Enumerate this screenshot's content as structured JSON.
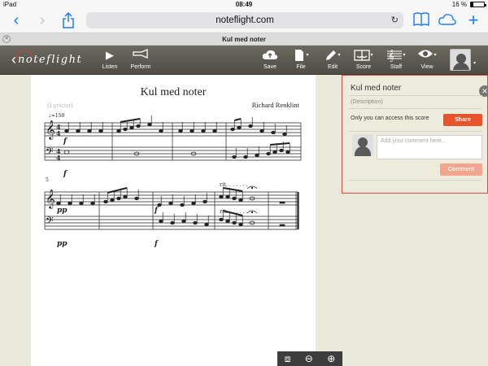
{
  "status": {
    "carrier": "iPad",
    "time": "08:49",
    "battery_text": "16 %",
    "battery_level": 0.16
  },
  "safari": {
    "back_icon": "chevron-left-icon",
    "forward_icon": "chevron-right-icon",
    "url": "noteflight.com",
    "tab_title": "Kul med noter"
  },
  "appbar": {
    "logo_text": "noteflight",
    "tools": [
      {
        "name": "listen",
        "label": "Listen",
        "icon": "play-icon",
        "has_menu": false
      },
      {
        "name": "perform",
        "label": "Perform",
        "icon": "horn-icon",
        "has_menu": false
      },
      {
        "name": "save",
        "label": "Save",
        "icon": "cloud-upload-icon",
        "has_menu": false
      },
      {
        "name": "file",
        "label": "File",
        "icon": "file-icon",
        "has_menu": true
      },
      {
        "name": "edit",
        "label": "Edit",
        "icon": "pencil-icon",
        "has_menu": true
      },
      {
        "name": "score",
        "label": "Score",
        "icon": "score-icon",
        "has_menu": true
      },
      {
        "name": "staff",
        "label": "Staff",
        "icon": "staff-icon",
        "has_menu": true
      },
      {
        "name": "view",
        "label": "View",
        "icon": "eye-icon",
        "has_menu": true
      }
    ]
  },
  "score": {
    "title": "Kul med noter",
    "composer": "Richard Renklint",
    "lyricist": "(Lyricist)",
    "tempo": "♩=150",
    "measure_number": "5",
    "dynamics": [
      "f",
      "f",
      "pp",
      "f",
      "pp",
      "f"
    ],
    "rit_text": "rit. . . . . . ."
  },
  "panel": {
    "title": "Kul med noter",
    "description_placeholder": "(Description)",
    "access_text": "Only you can access this score",
    "share_label": "Share",
    "comment_placeholder": "Add your comment here...",
    "comment_label": "Comment"
  },
  "colors": {
    "accent_red": "#d84a44",
    "share_orange": "#e8532a",
    "ios_blue": "#1a7cf5"
  }
}
